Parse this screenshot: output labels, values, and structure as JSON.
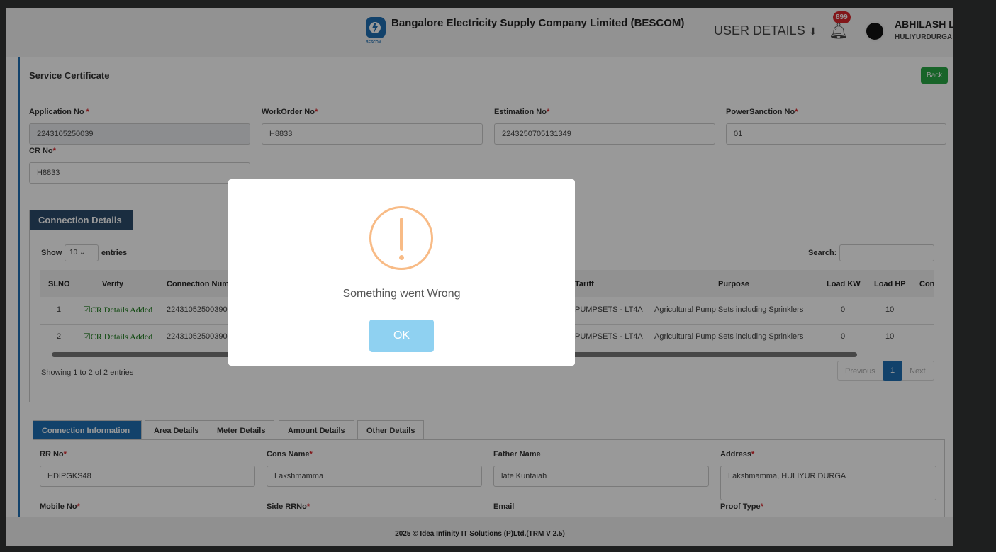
{
  "header": {
    "company": "Bangalore Electricity Supply Company Limited (BESCOM)",
    "logo_text": "BESCOM",
    "user_details": "USER DETAILS",
    "notif_count": "899",
    "user_name": "ABHILASH L",
    "user_location": "HULIYURDURGA"
  },
  "page": {
    "title": "Service Certificate",
    "back": "Back"
  },
  "fields": [
    {
      "label": "Application No",
      "value": "2243105250039"
    },
    {
      "label": "WorkOrder No",
      "value": "H8833"
    },
    {
      "label": "Estimation No",
      "value": "2243250705131349"
    },
    {
      "label": "PowerSanction No",
      "value": "01"
    },
    {
      "label": "CR No",
      "value": "H8833"
    }
  ],
  "connection": {
    "title": "Connection Details",
    "show": "Show",
    "entries_value": "10",
    "entries": "entries",
    "search": "Search:",
    "columns": [
      "SLNO",
      "Verify",
      "Connection Num",
      "Tariff",
      "Purpose",
      "Load KW",
      "Load HP",
      "Con"
    ],
    "rows": [
      {
        "slno": "1",
        "verify": "CR Details Added",
        "conn": "22431052500390",
        "tariff": "PUMPSETS - LT4A",
        "purpose": "Agricultural Pump Sets including Sprinklers",
        "kw": "0",
        "hp": "10"
      },
      {
        "slno": "2",
        "verify": "CR Details Added",
        "conn": "22431052500390",
        "tariff": "PUMPSETS - LT4A",
        "purpose": "Agricultural Pump Sets including Sprinklers",
        "kw": "0",
        "hp": "10"
      }
    ],
    "info": "Showing 1 to 2 of 2 entries",
    "prev": "Previous",
    "page": "1",
    "next": "Next"
  },
  "tabs": [
    "Connection Information",
    "Area Details",
    "Meter Details",
    "Amount Details",
    "Other Details"
  ],
  "info_fields": [
    {
      "label": "RR No",
      "value": "HDIPGKS48",
      "req": true
    },
    {
      "label": "Cons Name",
      "value": "Lakshmamma",
      "req": true
    },
    {
      "label": "Father Name",
      "value": "late Kuntaiah",
      "req": false
    },
    {
      "label": "Address",
      "value": "Lakshmamma, HULIYUR DURGA",
      "req": true
    },
    {
      "label": "Mobile No",
      "req": true
    },
    {
      "label": "Side RRNo",
      "req": true
    },
    {
      "label": "Email",
      "req": false
    },
    {
      "label": "Proof Type",
      "req": true
    }
  ],
  "footer": "2025 © Idea Infinity IT Solutions (P)Ltd.(TRM V 2.5)",
  "modal": {
    "message": "Something went Wrong",
    "ok": "OK"
  }
}
